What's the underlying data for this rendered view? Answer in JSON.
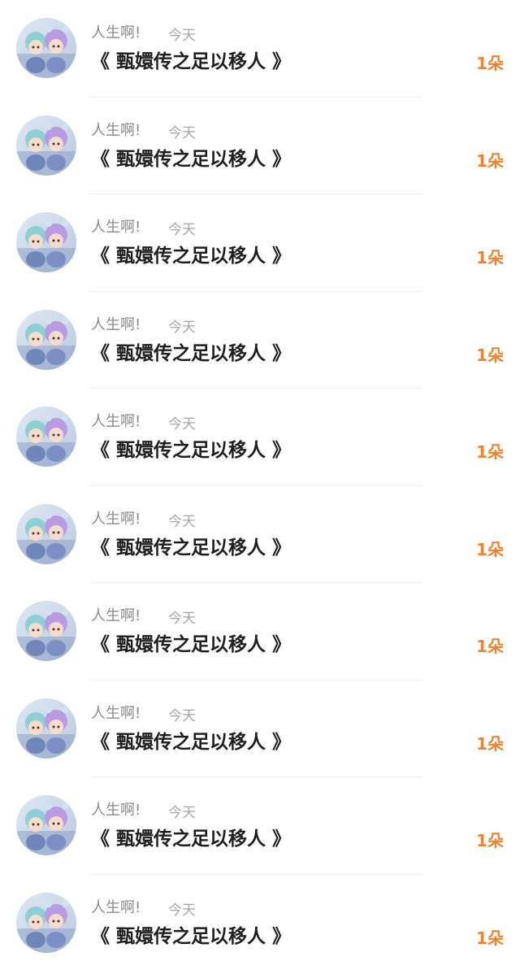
{
  "items": [
    {
      "username": "人生啊!",
      "time": "今天",
      "title": "《 甄嬛传之足以移人 》",
      "count": "1朵"
    },
    {
      "username": "人生啊!",
      "time": "今天",
      "title": "《 甄嬛传之足以移人 》",
      "count": "1朵"
    },
    {
      "username": "人生啊!",
      "time": "今天",
      "title": "《 甄嬛传之足以移人 》",
      "count": "1朵"
    },
    {
      "username": "人生啊!",
      "time": "今天",
      "title": "《 甄嬛传之足以移人 》",
      "count": "1朵"
    },
    {
      "username": "人生啊!",
      "time": "今天",
      "title": "《 甄嬛传之足以移人 》",
      "count": "1朵"
    },
    {
      "username": "人生啊!",
      "time": "今天",
      "title": "《 甄嬛传之足以移人 》",
      "count": "1朵"
    },
    {
      "username": "人生啊!",
      "time": "今天",
      "title": "《 甄嬛传之足以移人 》",
      "count": "1朵"
    },
    {
      "username": "人生啊!",
      "time": "今天",
      "title": "《 甄嬛传之足以移人 》",
      "count": "1朵"
    },
    {
      "username": "人生啊!",
      "time": "今天",
      "title": "《 甄嬛传之足以移人 》",
      "count": "1朵"
    },
    {
      "username": "人生啊!",
      "time": "今天",
      "title": "《 甄嬛传之足以移人 》",
      "count": "1朵"
    }
  ],
  "colors": {
    "accent": "#f0822f",
    "title": "#1e1e1e",
    "username": "#8a8a8a",
    "time": "#a6a6a6"
  }
}
